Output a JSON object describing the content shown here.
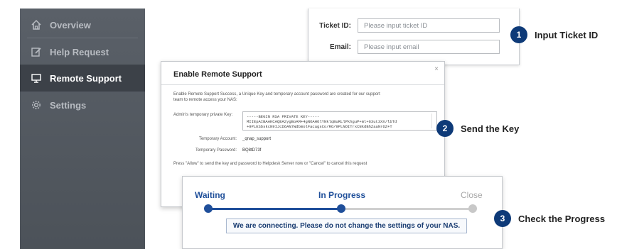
{
  "colors": {
    "sidebar_bg": "#51575e",
    "active_bg": "#3c4148",
    "accent_blue": "#0e3a78",
    "progress_blue": "#1f4f9a",
    "inactive_grey": "#c8c8c8"
  },
  "sidebar": {
    "items": [
      {
        "label": "Overview",
        "icon": "home-icon",
        "active": false
      },
      {
        "label": "Help Request",
        "icon": "edit-icon",
        "active": false
      },
      {
        "label": "Remote Support",
        "icon": "monitor-icon",
        "active": true
      },
      {
        "label": "Settings",
        "icon": "gear-icon",
        "active": false
      }
    ]
  },
  "ticket_form": {
    "ticket_id_label": "Ticket ID:",
    "ticket_id_placeholder": "Please input ticket ID",
    "email_label": "Email:",
    "email_placeholder": "Please input email"
  },
  "dialog": {
    "title": "Enable Remote Support",
    "close": "×",
    "description_line1": "Enable Remote Support Success, a Unique Key and temporary account password are created for our support",
    "description_line2": "team to remote access your NAS:",
    "key_label": "Admin's temporary private Key:",
    "key_line1": "-----BEGIN RSA PRIVATE KEY-----",
    "key_line2": "MIIEpAIBAAKCAQEA2ygBoAM+4gNOAHOlYNklqBuRLlPkhguP+ml+63ut3XX/lbTd",
    "key_line3": "+9PLESbskcN9IJcD6AN7WdbmolFacagsCo/RO/9PLNOITrxCNkdBhZaaNr6Z+T",
    "account_label": "Temporary Account:",
    "account_value": "_qnap_support",
    "password_label": "Temporary Password:",
    "password_value": "BQ8tD73f",
    "allow_note": "Press \"Allow\" to send the key and password to Helpdesk Server now or \"Cancel\" to cancel this request"
  },
  "progress": {
    "steps": [
      "Waiting",
      "In Progress",
      "Close"
    ],
    "current_step": 1,
    "message": "We are connecting. Please do not change the settings of your NAS."
  },
  "callouts": [
    {
      "number": "1",
      "text": "Input Ticket ID"
    },
    {
      "number": "2",
      "text": "Send the Key"
    },
    {
      "number": "3",
      "text": "Check the Progress"
    }
  ]
}
